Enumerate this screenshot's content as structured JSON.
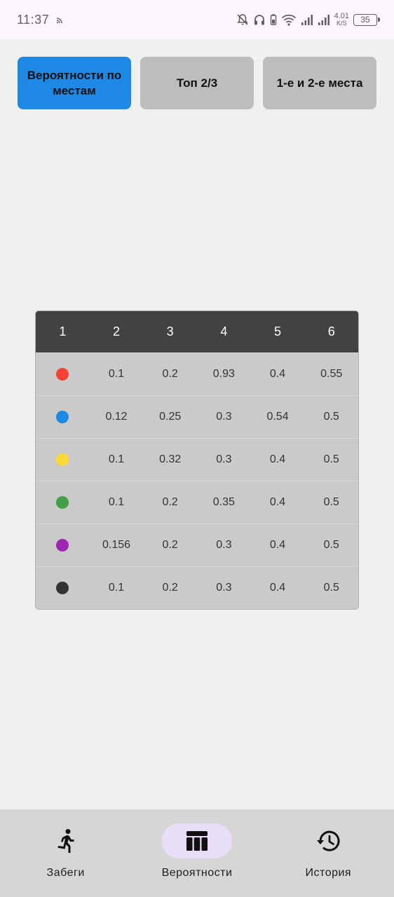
{
  "status_bar": {
    "time": "11:37",
    "net_speed_value": "4.01",
    "net_speed_unit": "K/S",
    "battery": "35",
    "icons": [
      "cast-icon",
      "bell-off-icon",
      "headphones-icon",
      "battery-saver-icon",
      "wifi-icon",
      "signal-icon",
      "signal-icon"
    ]
  },
  "tabs": [
    {
      "label": "Вероятности по местам",
      "active": true
    },
    {
      "label": "Топ 2/3",
      "active": false
    },
    {
      "label": "1-е и 2-е места",
      "active": false
    }
  ],
  "table": {
    "headers": [
      "1",
      "2",
      "3",
      "4",
      "5",
      "6"
    ],
    "rows": [
      {
        "color": "#f44336",
        "color_name": "red",
        "values": [
          "0.1",
          "0.2",
          "0.93",
          "0.4",
          "0.55"
        ]
      },
      {
        "color": "#1e88e5",
        "color_name": "blue",
        "values": [
          "0.12",
          "0.25",
          "0.3",
          "0.54",
          "0.5"
        ]
      },
      {
        "color": "#fdd835",
        "color_name": "yellow",
        "values": [
          "0.1",
          "0.32",
          "0.3",
          "0.4",
          "0.5"
        ]
      },
      {
        "color": "#43a047",
        "color_name": "green",
        "values": [
          "0.1",
          "0.2",
          "0.35",
          "0.4",
          "0.5"
        ]
      },
      {
        "color": "#9c27b0",
        "color_name": "purple",
        "values": [
          "0.156",
          "0.2",
          "0.3",
          "0.4",
          "0.5"
        ]
      },
      {
        "color": "#333333",
        "color_name": "black",
        "values": [
          "0.1",
          "0.2",
          "0.3",
          "0.4",
          "0.5"
        ]
      }
    ]
  },
  "bottom_nav": {
    "items": [
      {
        "label": "Забеги",
        "icon": "running-icon",
        "active": false
      },
      {
        "label": "Вероятности",
        "icon": "table-icon",
        "active": true
      },
      {
        "label": "История",
        "icon": "history-icon",
        "active": false
      }
    ]
  },
  "colors": {
    "accent": "#1e88e5",
    "tab_inactive": "#bdbdbd",
    "table_header": "#424242",
    "table_body": "#cacaca",
    "nav_background": "#d6d6d6",
    "nav_active_pill": "#e8def8"
  }
}
